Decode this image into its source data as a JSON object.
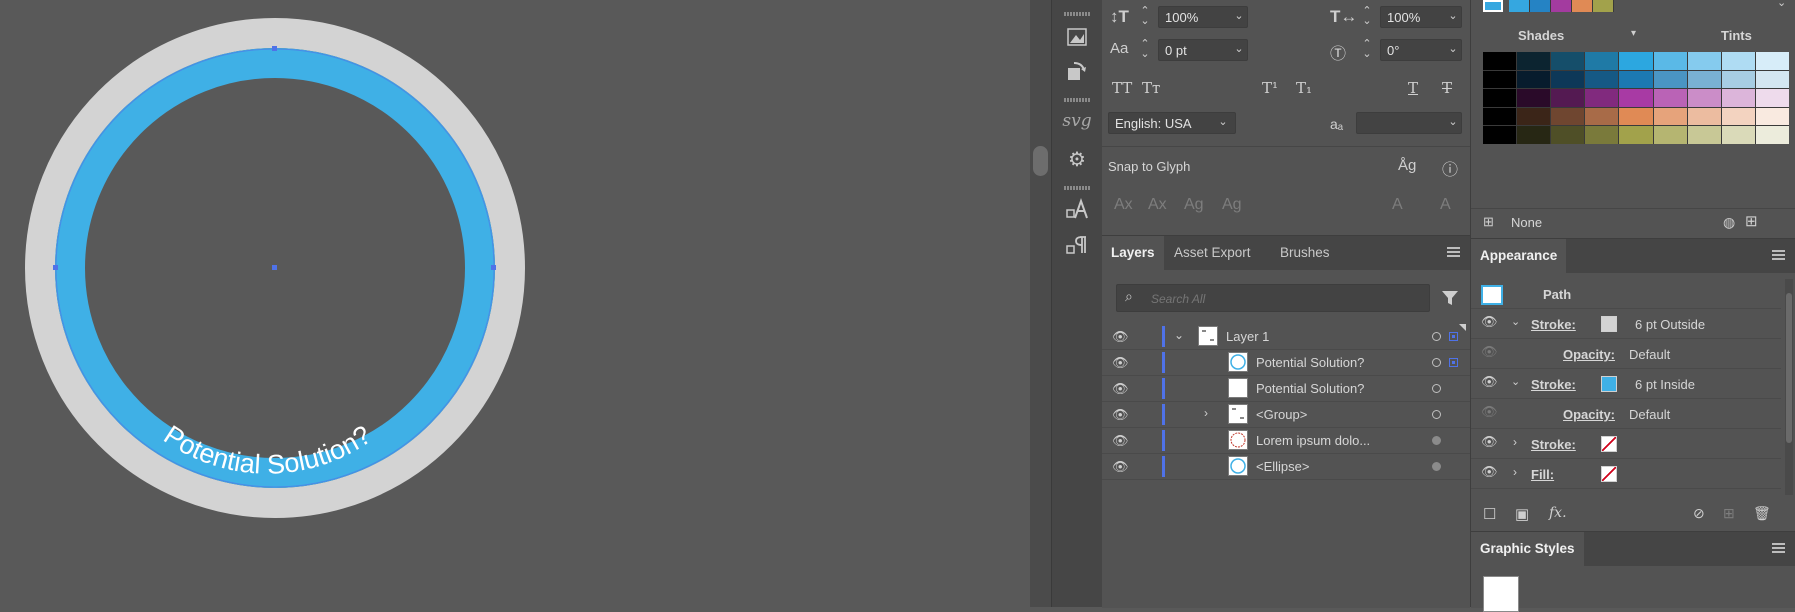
{
  "canvas": {
    "artwork_text": "Potential Solution?",
    "outer_ring_color": "#d3d3d3",
    "inner_ring_color": "#3fb0e6"
  },
  "character_panel": {
    "vertical_scale": "100%",
    "horizontal_scale": "100%",
    "baseline_shift": "0 pt",
    "rotation": "0°",
    "language": "English: USA",
    "antialias_value": "",
    "snap_to_glyph": "Snap to Glyph"
  },
  "tools": [
    "image-trace-icon",
    "replace-icon",
    "svg-icon",
    "gear-icon",
    "char-style-icon",
    "para-style-icon"
  ],
  "tool_labels": {
    "svg": "svg"
  },
  "swatches": {
    "shades_label": "Shades",
    "tints_label": "Tints",
    "none_label": "None",
    "top_swatches": [
      "#35a7e0",
      "#2583c4",
      "#a33b9f",
      "#e08a55",
      "#a2a24b"
    ],
    "grid": [
      [
        "#000000",
        "#0c2430",
        "#154e6a",
        "#1f7aa6",
        "#2ca7e0",
        "#5ab9e7",
        "#85cbee",
        "#afdcf3",
        "#d7edf9"
      ],
      [
        "#000000",
        "#071c2d",
        "#0d3858",
        "#155985",
        "#1c79b2",
        "#4a95c3",
        "#79b1d3",
        "#a7cde3",
        "#d3e6f1"
      ],
      [
        "#000000",
        "#2a0a29",
        "#541a52",
        "#812a7e",
        "#a83aa4",
        "#ba63b6",
        "#cb8dc8",
        "#dcb5da",
        "#eedbec"
      ],
      [
        "#000000",
        "#3b2518",
        "#6f4630",
        "#a86b48",
        "#e08a55",
        "#e6a37b",
        "#ecbca0",
        "#f3d3c0",
        "#f9eae0"
      ],
      [
        "#000000",
        "#272714",
        "#4f4f27",
        "#7a7a3b",
        "#a2a24b",
        "#b5b571",
        "#c8c896",
        "#dadab9",
        "#ececdc"
      ]
    ]
  },
  "layers_panel": {
    "tabs": [
      "Layers",
      "Asset Export",
      "Brushes"
    ],
    "search_placeholder": "Search All",
    "rows": [
      {
        "name": "Layer 1",
        "indent": 0
      },
      {
        "name": "Potential Solution?",
        "indent": 1
      },
      {
        "name": "Potential Solution?",
        "indent": 1
      },
      {
        "name": "<Group>",
        "indent": 1
      },
      {
        "name": "Lorem ipsum dolo...",
        "indent": 1
      },
      {
        "name": "<Ellipse>",
        "indent": 1
      }
    ]
  },
  "appearance_panel": {
    "title": "Appearance",
    "object_type": "Path",
    "stroke_label": "Stroke:",
    "fill_label": "Fill:",
    "opacity_label": "Opacity:",
    "opacity_value": "Default",
    "stroke1_value": "6 pt  Outside",
    "stroke2_value": "6 pt  Inside",
    "stroke1_color": "#d3d3d3",
    "stroke2_color": "#3fb0e6"
  },
  "graphic_styles": {
    "title": "Graphic Styles"
  }
}
